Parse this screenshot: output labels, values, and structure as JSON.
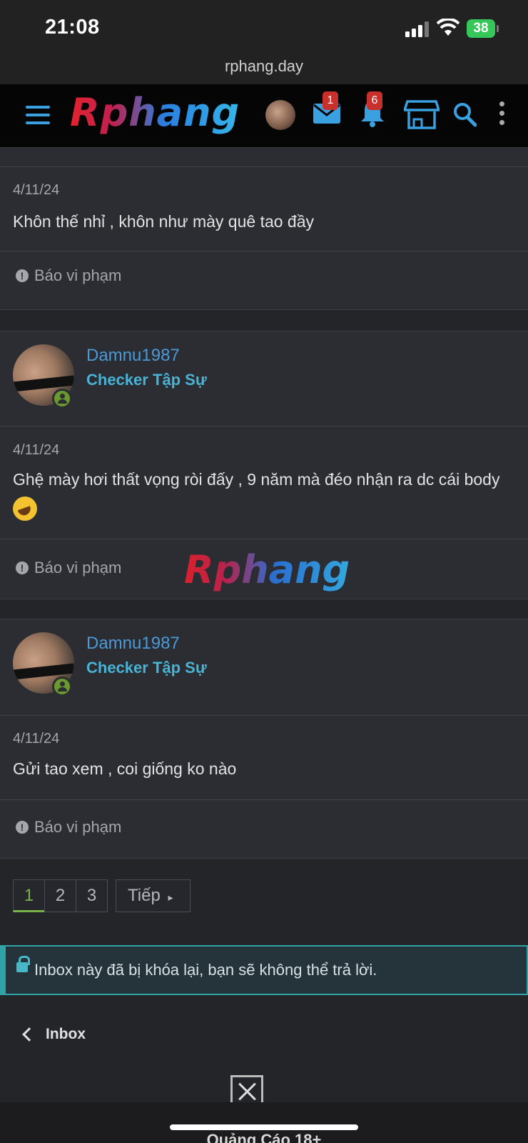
{
  "status_bar": {
    "time": "21:08",
    "battery": "38"
  },
  "browser": {
    "url": "rphang.day"
  },
  "header": {
    "logo": "Rphang",
    "mail_badge": "1",
    "alerts_badge": "6",
    "accent_color": "#3aa0e0"
  },
  "posts": [
    {
      "date": "4/11/24",
      "text": "Khôn thế nhỉ , khôn như mày quê tao đầy",
      "report": "Báo vi phạm"
    },
    {
      "username": "Damnu1987",
      "user_title": "Checker Tập Sự",
      "date": "4/11/24",
      "text": "Ghệ mày hơi thất vọng ròi đấy , 9 năm mà đéo nhận ra dc cái body",
      "emoji": "rolling-on-floor-laughing",
      "report": "Báo vi phạm"
    },
    {
      "username": "Damnu1987",
      "user_title": "Checker Tập Sự",
      "date": "4/11/24",
      "text": "Gửi tao xem , coi giống ko nào",
      "report": "Báo vi phạm"
    }
  ],
  "watermark": "Rphang",
  "pagination": {
    "pages": [
      "1",
      "2",
      "3"
    ],
    "current": "1",
    "next": "Tiếp"
  },
  "locked_notice": "Inbox này đã bị khóa lại, bạn sẽ không thể trả lời.",
  "back_link": "Inbox",
  "ad": {
    "label": "Quảng Cáo 18+"
  }
}
